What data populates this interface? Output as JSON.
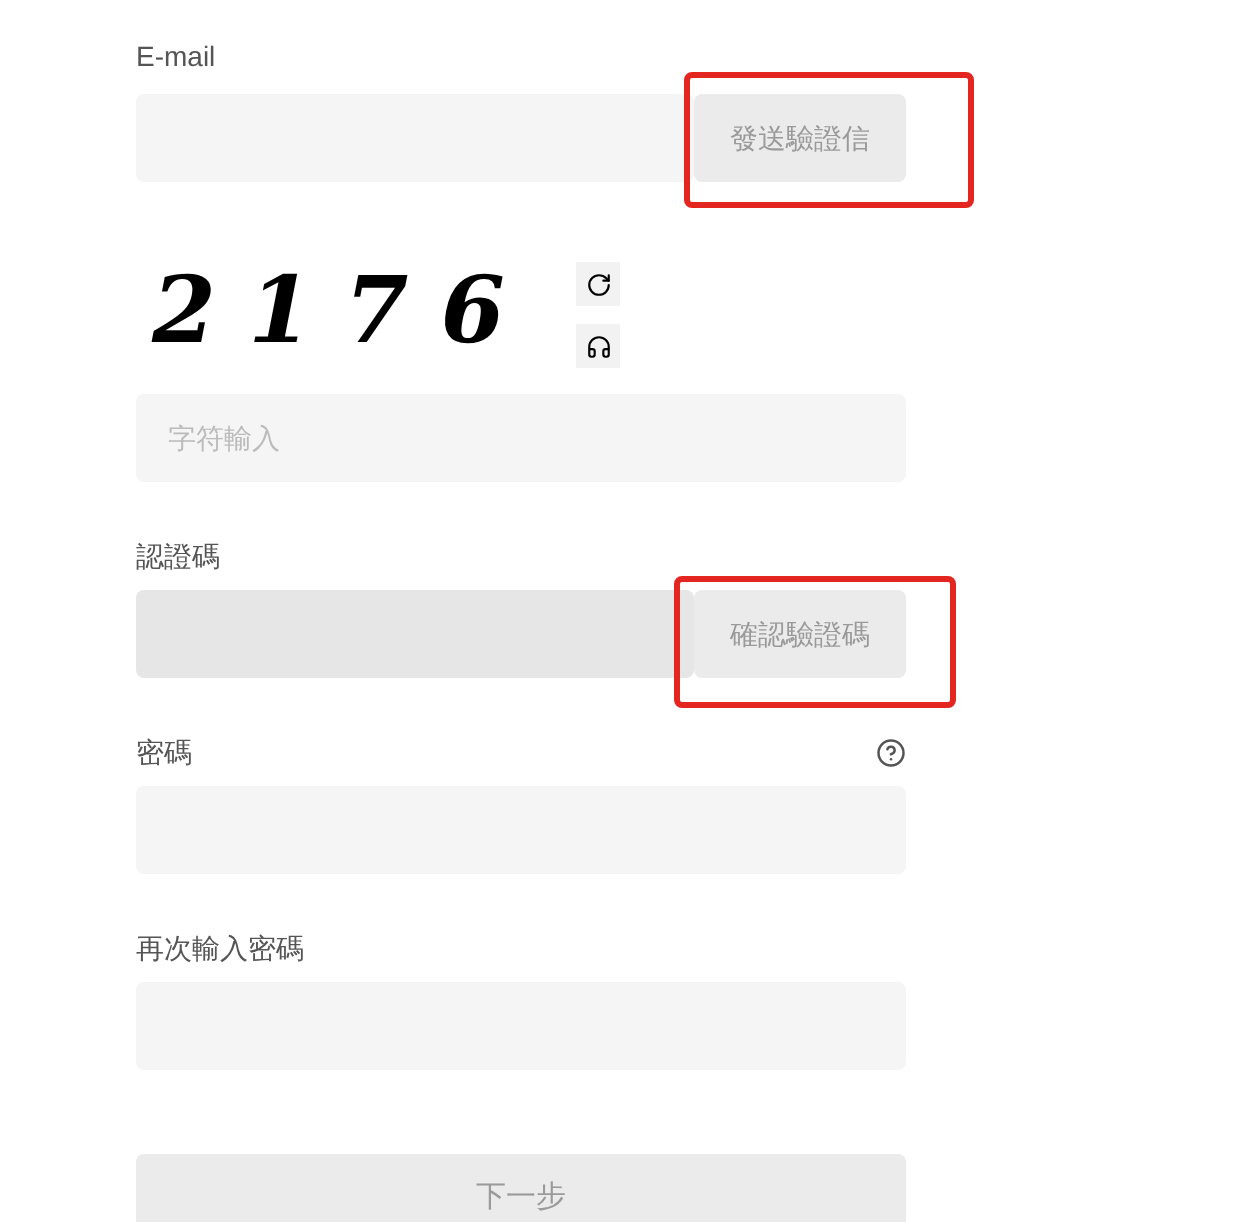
{
  "email": {
    "label": "E-mail",
    "send_button": {
      "label": "發送驗證信",
      "disabled": true
    }
  },
  "captcha": {
    "text": "2176",
    "input_placeholder": "字符輸入"
  },
  "verification": {
    "label": "認證碼",
    "disabled": true,
    "confirm_button": {
      "label": "確認驗證碼",
      "disabled": true
    }
  },
  "password": {
    "label": "密碼"
  },
  "confirm_password": {
    "label": "再次輸入密碼"
  },
  "next_button": {
    "label": "下一步",
    "disabled": true
  },
  "annotations": [
    {
      "kind": "highlight-box"
    },
    {
      "kind": "highlight-box"
    }
  ]
}
